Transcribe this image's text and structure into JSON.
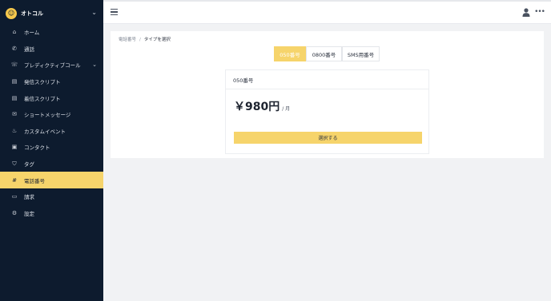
{
  "brand": {
    "name": "オトコル",
    "logo_glyph": "☺"
  },
  "sidebar": {
    "items": [
      {
        "label": "ホーム",
        "icon": "home-icon",
        "glyph": "⌂"
      },
      {
        "label": "通話",
        "icon": "phone-icon",
        "glyph": "✆"
      },
      {
        "label": "プレディクティブコール",
        "icon": "predictive-call-icon",
        "glyph": "☏",
        "expandable": true
      },
      {
        "label": "発信スクリプト",
        "icon": "outgoing-script-icon",
        "glyph": "▤"
      },
      {
        "label": "着信スクリプト",
        "icon": "incoming-script-icon",
        "glyph": "▤"
      },
      {
        "label": "ショートメッセージ",
        "icon": "short-message-icon",
        "glyph": "✉"
      },
      {
        "label": "カスタムイベント",
        "icon": "custom-event-icon",
        "glyph": "♨"
      },
      {
        "label": "コンタクト",
        "icon": "contact-icon",
        "glyph": "▣"
      },
      {
        "label": "タグ",
        "icon": "tag-icon",
        "glyph": "⛉"
      },
      {
        "label": "電話番号",
        "icon": "hash-icon",
        "glyph": "#",
        "active": true
      },
      {
        "label": "請求",
        "icon": "billing-icon",
        "glyph": "▭"
      },
      {
        "label": "設定",
        "icon": "gear-icon",
        "glyph": "⚙"
      }
    ]
  },
  "breadcrumb": {
    "parent": "電話番号",
    "separator": "/",
    "current": "タイプを選択"
  },
  "tabs": [
    {
      "label": "050番号",
      "active": true
    },
    {
      "label": "0800番号",
      "active": false
    },
    {
      "label": "SMS用番号",
      "active": false
    }
  ],
  "plan": {
    "name": "050番号",
    "price": "￥980円",
    "unit": "/ 月",
    "button_label": "選択する"
  },
  "colors": {
    "sidebar_bg": "#0d1b2e",
    "accent": "#f6d46b",
    "page_bg": "#f1f2f4"
  }
}
